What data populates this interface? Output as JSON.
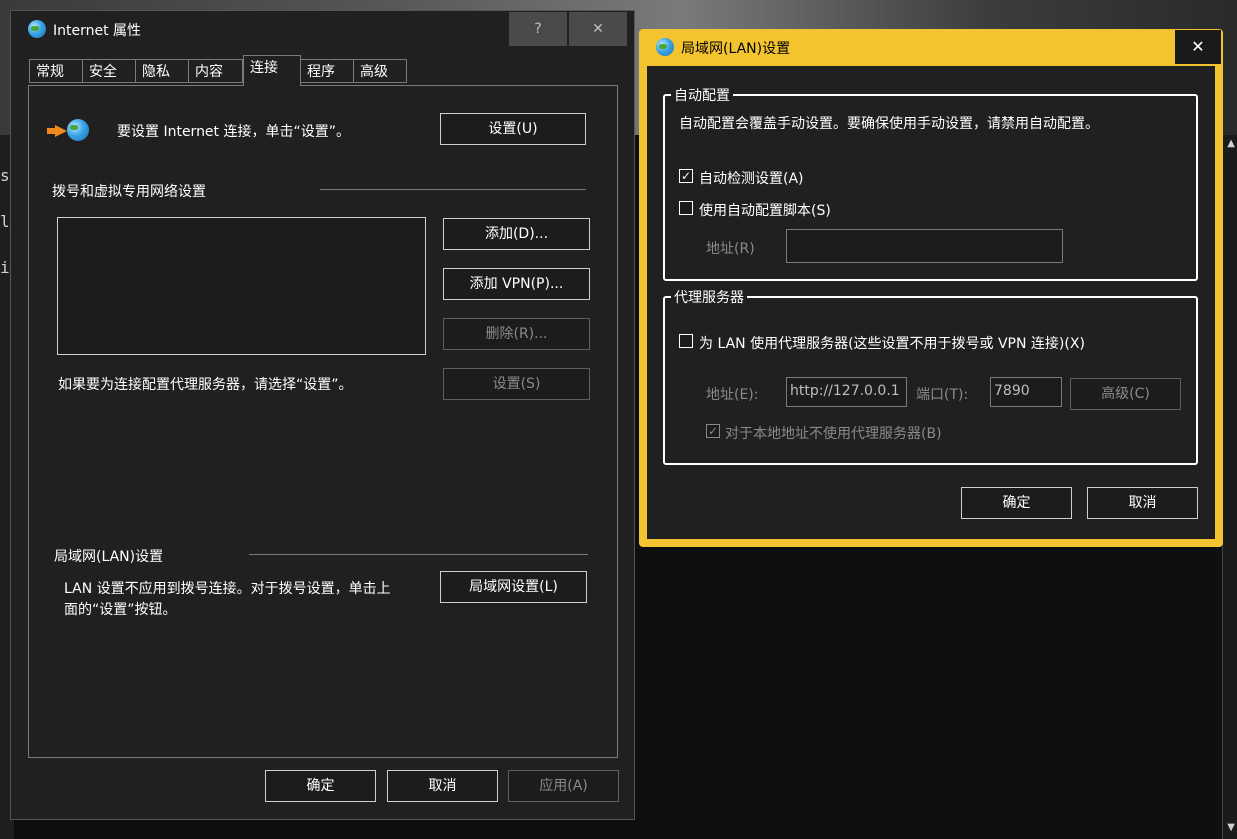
{
  "background": {
    "code_chars": [
      "s",
      "l",
      "i"
    ]
  },
  "internet_properties": {
    "title": "Internet 属性",
    "help_button": "?",
    "close_button": "✕",
    "tabs": [
      "常规",
      "安全",
      "隐私",
      "内容",
      "连接",
      "程序",
      "高级"
    ],
    "active_tab": "连接",
    "setup_text": "要设置 Internet 连接，单击“设置”。",
    "setup_button": "设置(U)",
    "dialup_section_title": "拨号和虚拟专用网络设置",
    "add_button": "添加(D)...",
    "add_vpn_button": "添加 VPN(P)...",
    "remove_button": "删除(R)...",
    "proxy_text": "如果要为连接配置代理服务器，请选择“设置”。",
    "settings_button": "设置(S)",
    "lan_section_title": "局域网(LAN)设置",
    "lan_text_line1": "LAN 设置不应用到拨号连接。对于拨号设置，单击上",
    "lan_text_line2": "面的“设置”按钮。",
    "lan_settings_button": "局域网设置(L)",
    "ok_button": "确定",
    "cancel_button": "取消",
    "apply_button": "应用(A)"
  },
  "lan_dialog": {
    "title": "局域网(LAN)设置",
    "close_button": "✕",
    "auto_config": {
      "group_title": "自动配置",
      "description": "自动配置会覆盖手动设置。要确保使用手动设置，请禁用自动配置。",
      "auto_detect_label": "自动检测设置(A)",
      "auto_detect_checked": true,
      "use_script_label": "使用自动配置脚本(S)",
      "use_script_checked": false,
      "address_label": "地址(R)",
      "address_value": ""
    },
    "proxy": {
      "group_title": "代理服务器",
      "use_proxy_label": "为 LAN 使用代理服务器(这些设置不用于拨号或 VPN 连接)(X)",
      "use_proxy_checked": false,
      "address_label": "地址(E):",
      "address_value": "http://127.0.0.1",
      "port_label": "端口(T):",
      "port_value": "7890",
      "advanced_button": "高级(C)",
      "bypass_local_label": "对于本地地址不使用代理服务器(B)",
      "bypass_local_checked": true
    },
    "ok_button": "确定",
    "cancel_button": "取消"
  },
  "colors": {
    "window_bg": "#202020",
    "accent_border": "#f4c430",
    "button_border": "#cfcfcf",
    "disabled_text": "#8a8a8a"
  }
}
